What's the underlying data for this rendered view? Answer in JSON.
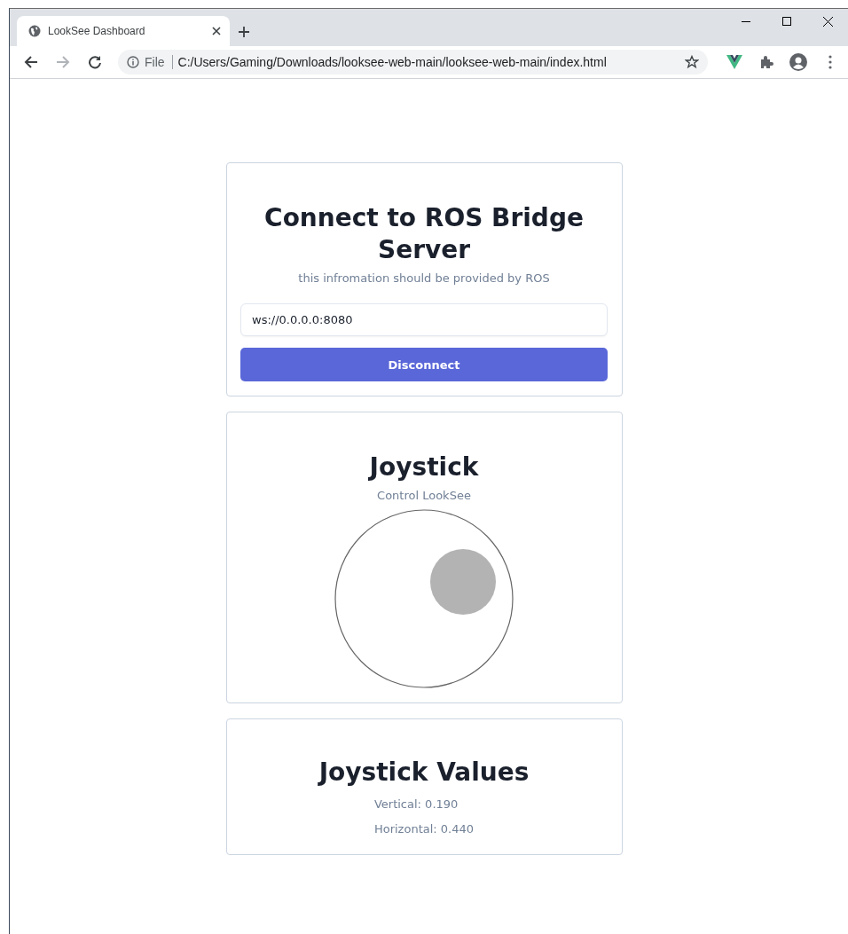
{
  "browser": {
    "tab_title": "LookSee Dashboard",
    "scheme_label": "File",
    "url": "C:/Users/Gaming/Downloads/looksee-web-main/looksee-web-main/index.html"
  },
  "connect_card": {
    "title": "Connect to ROS Bridge Server",
    "subtitle": "this infromation should be provided by ROS",
    "address_value": "ws://0.0.0.0:8080",
    "button": "Disconnect"
  },
  "joystick_card": {
    "title": "Joystick",
    "subtitle": "Control LookSee"
  },
  "values_card": {
    "title": "Joystick Values",
    "lines": [
      "Vertical: 0.190",
      "Horizontal: 0.440"
    ]
  }
}
